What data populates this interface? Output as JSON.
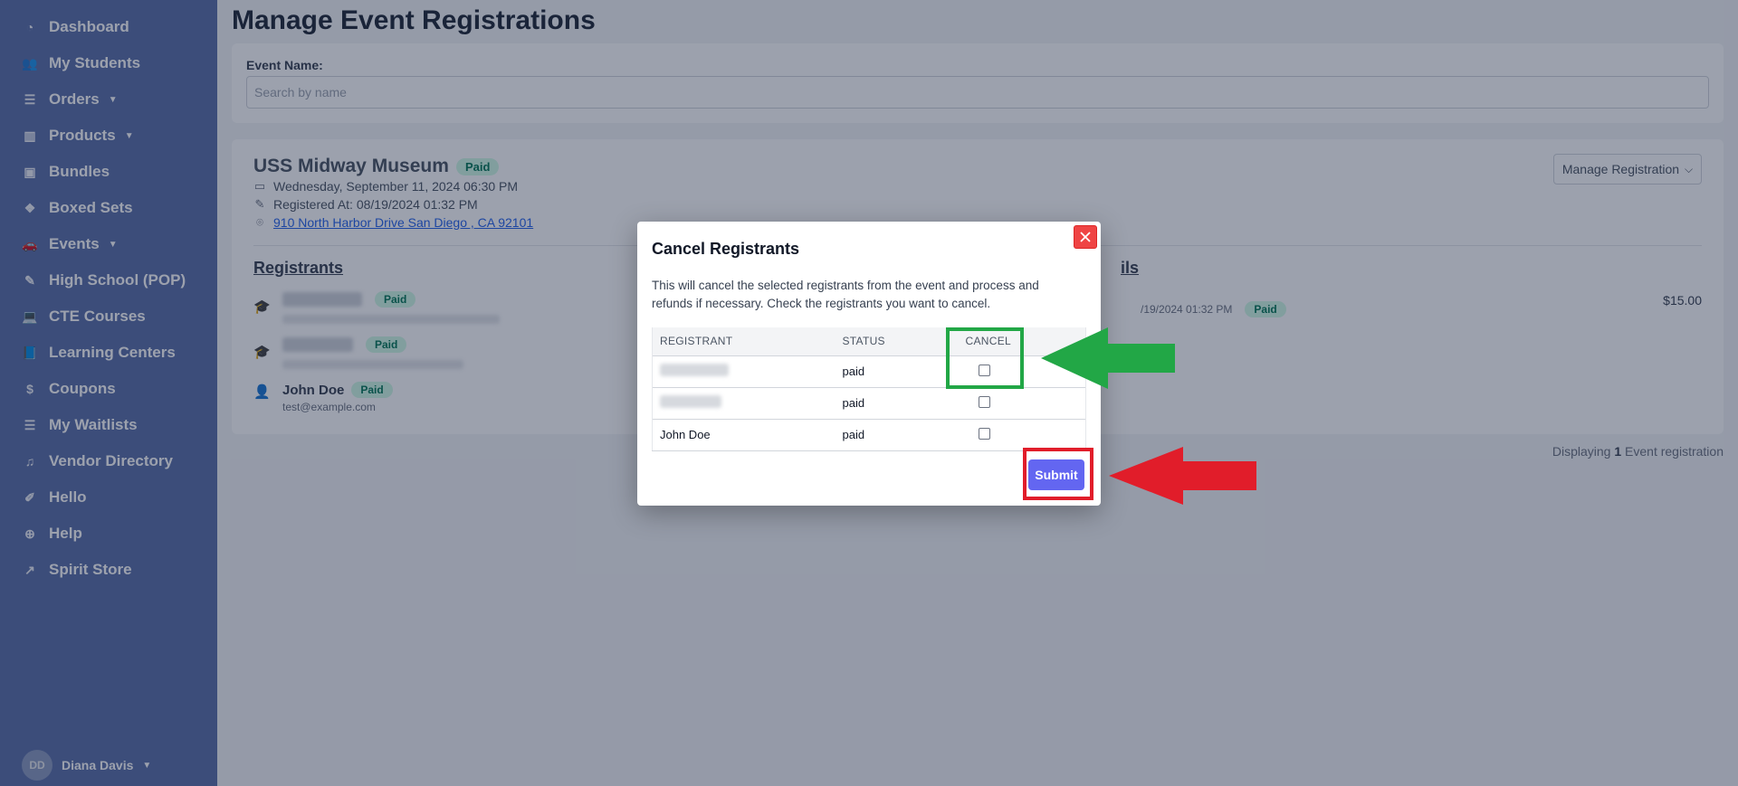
{
  "sidebar": {
    "items": [
      {
        "label": "Dashboard",
        "icon": "dashboard-icon",
        "glyph": "◔"
      },
      {
        "label": "My Students",
        "icon": "users-icon",
        "glyph": "👥"
      },
      {
        "label": "Orders",
        "icon": "list-icon",
        "glyph": "☰",
        "caret": "▼"
      },
      {
        "label": "Products",
        "icon": "barcode-icon",
        "glyph": "▥",
        "caret": "▼"
      },
      {
        "label": "Bundles",
        "icon": "briefcase-icon",
        "glyph": "▣"
      },
      {
        "label": "Boxed Sets",
        "icon": "boxes-icon",
        "glyph": "❖"
      },
      {
        "label": "Events",
        "icon": "car-icon",
        "glyph": "🚗",
        "caret": "▼"
      },
      {
        "label": "High School (POP)",
        "icon": "pencil-icon",
        "glyph": "✎"
      },
      {
        "label": "CTE Courses",
        "icon": "laptop-icon",
        "glyph": "💻"
      },
      {
        "label": "Learning Centers",
        "icon": "book-icon",
        "glyph": "📘"
      },
      {
        "label": "Coupons",
        "icon": "dollar-icon",
        "glyph": "$"
      },
      {
        "label": "My Waitlists",
        "icon": "list-icon",
        "glyph": "☰"
      },
      {
        "label": "Vendor Directory",
        "icon": "music-icon",
        "glyph": "♫"
      },
      {
        "label": "Hello",
        "icon": "edit-square-icon",
        "glyph": "✐"
      },
      {
        "label": "Help",
        "icon": "lifebuoy-icon",
        "glyph": "⊕"
      },
      {
        "label": "Spirit Store",
        "icon": "external-link-icon",
        "glyph": "↗"
      }
    ],
    "user": {
      "initials": "DD",
      "name": "Diana Davis",
      "caret": "▼"
    }
  },
  "main": {
    "page_title": "Manage Event Registrations",
    "search": {
      "label": "Event Name:",
      "placeholder": "Search by name"
    },
    "event": {
      "title": "USS Midway Museum",
      "status": "Paid",
      "date": "Wednesday, September 11, 2024 06:30 PM",
      "registered_at": "Registered At: 08/19/2024 01:32 PM",
      "address": "910 North Harbor Drive San Diego , CA 92101",
      "manage_label": "Manage Registration",
      "manage_caret": "⌵",
      "registrants_heading": "Registrants",
      "details_heading_partial": "ils",
      "registrants": [
        {
          "status": "Paid"
        },
        {
          "status": "Paid"
        },
        {
          "name": "John Doe",
          "status": "Paid",
          "email": "test@example.com"
        }
      ],
      "payment_date_partial": "/19/2024 01:32 PM",
      "payment_status": "Paid",
      "amount": "$15.00"
    },
    "displaying": {
      "prefix": "Displaying ",
      "count": "1",
      "suffix": " Event registration"
    }
  },
  "modal": {
    "title": "Cancel Registrants",
    "description": "This will cancel the selected registrants from the event and process and refunds if necessary. Check the registrants you want to cancel.",
    "columns": [
      "REGISTRANT",
      "STATUS",
      "CANCEL"
    ],
    "rows": [
      {
        "registrant": "",
        "status": "paid"
      },
      {
        "registrant": "",
        "status": "paid"
      },
      {
        "registrant": "John Doe",
        "status": "paid"
      }
    ],
    "submit_label": "Submit"
  },
  "annotation_colors": {
    "green": "#22a746",
    "red": "#e11d2a"
  }
}
